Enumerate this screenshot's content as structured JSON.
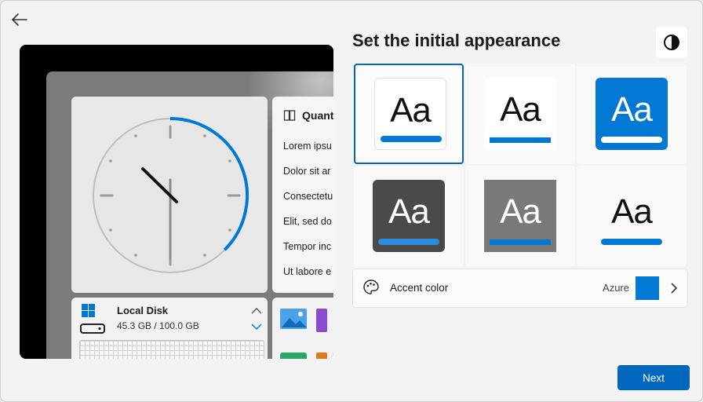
{
  "header": {
    "title": "Set the initial appearance"
  },
  "preview": {
    "list_widget": {
      "title": "Quant",
      "items": [
        "Lorem ipsu",
        "Dolor sit ar",
        "Consectetu",
        "Elit, sed do",
        "Tempor inc",
        "Ut labore e"
      ]
    },
    "disk_widget": {
      "title": "Local Disk",
      "usage": "45.3 GB / 100.0 GB"
    }
  },
  "themes": [
    {
      "label": "Aa",
      "selected": true
    },
    {
      "label": "Aa",
      "selected": false
    },
    {
      "label": "Aa",
      "selected": false
    },
    {
      "label": "Aa",
      "selected": false
    },
    {
      "label": "Aa",
      "selected": false
    },
    {
      "label": "Aa",
      "selected": false
    }
  ],
  "accent": {
    "label": "Accent color",
    "value": "Azure",
    "color": "#0078d4"
  },
  "footer": {
    "next_label": "Next"
  },
  "icons": {
    "back": "back-arrow-icon",
    "contrast": "contrast-icon",
    "palette": "palette-icon",
    "chevron": "chevron-right-icon"
  }
}
